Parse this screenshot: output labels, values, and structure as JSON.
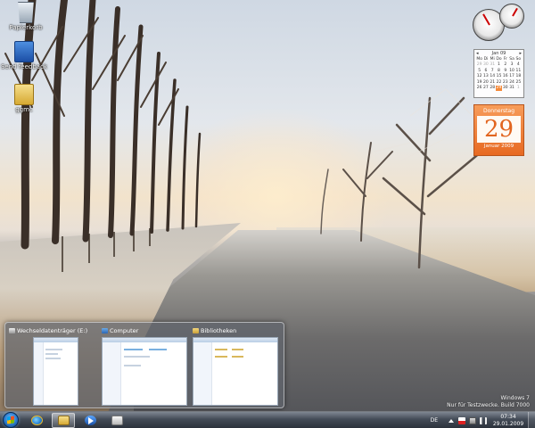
{
  "desktop": {
    "icons": [
      {
        "label": "Papierkorb",
        "icon": "recycle-bin-icon"
      },
      {
        "label": "Send feedback",
        "icon": "feedback-icon"
      },
      {
        "label": "ggmc",
        "icon": "folder-icon"
      }
    ]
  },
  "gadgets": {
    "calendar": {
      "month_label": "Jan 09",
      "weekdays": [
        "Mo",
        "Di",
        "Mi",
        "Do",
        "Fr",
        "Sa",
        "So"
      ],
      "days": [
        "29",
        "30",
        "31",
        "1",
        "2",
        "3",
        "4",
        "5",
        "6",
        "7",
        "8",
        "9",
        "10",
        "11",
        "12",
        "13",
        "14",
        "15",
        "16",
        "17",
        "18",
        "19",
        "20",
        "21",
        "22",
        "23",
        "24",
        "25",
        "26",
        "27",
        "28",
        "29",
        "30",
        "31",
        "1"
      ],
      "today": "29"
    },
    "date_card": {
      "weekday": "Donnerstag",
      "day": "29",
      "month_year": "Januar 2009"
    }
  },
  "watermark": {
    "line1": "Windows 7",
    "line2": "Nur für Testzwecke. Build 7000"
  },
  "flyout": {
    "thumbnails": [
      {
        "title": "Wechseldatenträger (E:)",
        "icon": "drive-icon"
      },
      {
        "title": "Computer",
        "icon": "computer-icon"
      },
      {
        "title": "Bibliotheken",
        "icon": "library-icon"
      }
    ]
  },
  "taskbar": {
    "apps": [
      {
        "name": "Internet Explorer",
        "icon": "ie-icon"
      },
      {
        "name": "Windows Explorer",
        "icon": "explorer-icon",
        "active": true
      },
      {
        "name": "Windows Media Player",
        "icon": "media-player-icon"
      },
      {
        "name": "Programm",
        "icon": "app-icon"
      }
    ],
    "language": "DE",
    "clock": {
      "time": "07:34",
      "date": "29.01.2009"
    }
  },
  "colors": {
    "accent_orange": "#e76a23",
    "taskbar_dark": "#282e38",
    "start_blue": "#2a78c9"
  }
}
